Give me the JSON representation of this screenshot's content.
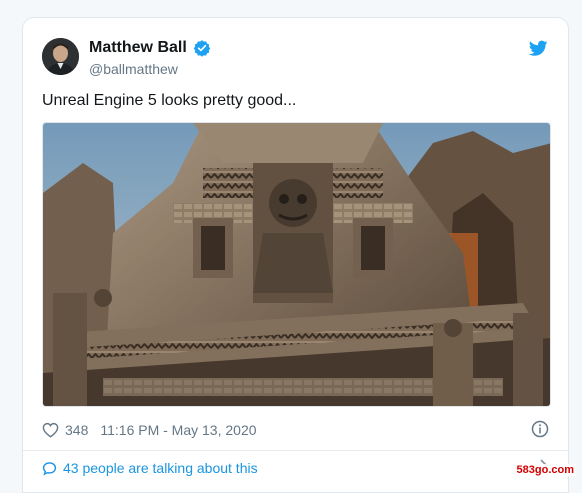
{
  "tweet": {
    "author_name": "Matthew Ball",
    "author_handle": "@ballmatthew",
    "text": "Unreal Engine 5 looks pretty good...",
    "likes": "348",
    "timestamp": "11:16 PM - May 13, 2020",
    "conversation_label": "43 people are talking about this"
  },
  "watermark": "583go.com",
  "colors": {
    "link_blue": "#1b95e0",
    "verified_blue": "#1da1f2",
    "text_dark": "#14171a",
    "text_muted": "#657786"
  },
  "icons": {
    "verified": "verified-badge-icon",
    "brand": "twitter-bird-icon",
    "like": "heart-icon",
    "info": "info-icon",
    "conversation": "speech-bubble-icon",
    "more": "chevron-right-icon"
  }
}
